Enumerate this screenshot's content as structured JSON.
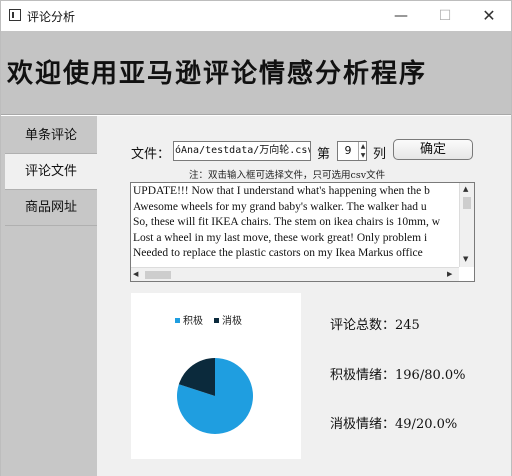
{
  "window": {
    "title": "评论分析",
    "minimize_glyph": "—",
    "maximize_glyph": "☐",
    "close_glyph": "✕"
  },
  "banner": {
    "title": "欢迎使用亚马逊评论情感分析程序"
  },
  "sidebar": {
    "items": [
      {
        "label": "单条评论",
        "active": false
      },
      {
        "label": "评论文件",
        "active": true
      },
      {
        "label": "商品网址",
        "active": false
      }
    ]
  },
  "file": {
    "label": "文件：",
    "value": "óAna/testdata/万向轮.csv",
    "column_prefix": "第",
    "column_value": "9",
    "column_suffix": "列",
    "confirm_label": "确定",
    "hint": "注：双击输入框可选择文件，只可选用csv文件"
  },
  "reviews": [
    "UPDATE!!! Now that I understand what's happening when the b",
    "Awesome wheels for my grand baby's walker. The walker had u",
    "So, these will fit IKEA chairs. The stem on ikea chairs is 10mm, w",
    "Lost a wheel in my last move, these work great! Only problem i",
    "Needed to replace the plastic castors on my Ikea Markus office"
  ],
  "chart_data": {
    "type": "pie",
    "categories": [
      "积极",
      "消极"
    ],
    "values": [
      196,
      49
    ],
    "colors": [
      "#1f9ee0",
      "#0b2a3c"
    ],
    "legend": "top"
  },
  "stats": {
    "total_label": "评论总数：",
    "total": "245",
    "positive_label": "积极情绪：",
    "positive": "196/80.0%",
    "negative_label": "消极情绪：",
    "negative": "49/20.0%"
  }
}
